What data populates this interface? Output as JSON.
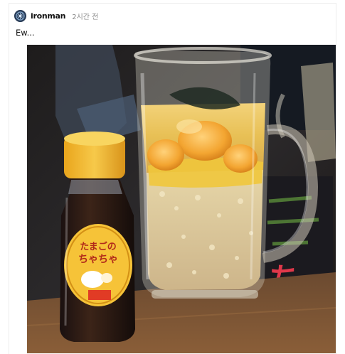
{
  "post": {
    "username": "ironman",
    "time": "2시간 전",
    "text": "Ew..."
  },
  "photo": {
    "bottle_label_line1": "たまごの",
    "bottle_label_line2": "ちゃちゃ",
    "sign_text": "ち"
  },
  "icons": {
    "avatar": "avatar-icon"
  },
  "colors": {
    "username": "#111111",
    "time": "#8a8a8a",
    "frame": "#ececec"
  }
}
